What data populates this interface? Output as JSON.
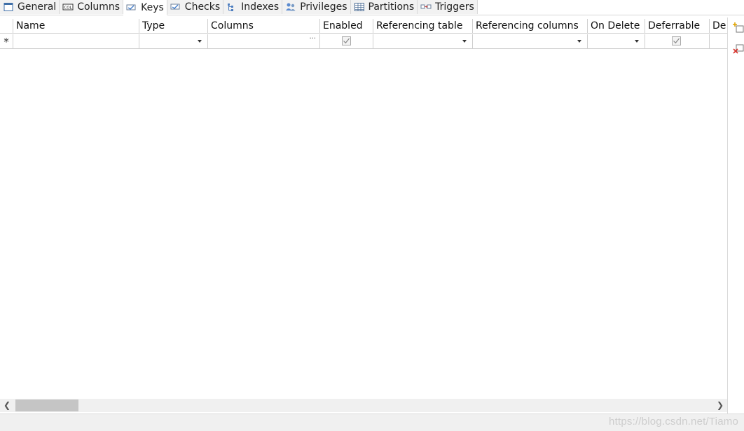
{
  "tabs": [
    {
      "label": "General",
      "icon": "window-icon",
      "active": false
    },
    {
      "label": "Columns",
      "icon": "columns-icon",
      "active": false
    },
    {
      "label": "Keys",
      "icon": "key-icon",
      "active": true
    },
    {
      "label": "Checks",
      "icon": "check-icon",
      "active": false
    },
    {
      "label": "Indexes",
      "icon": "index-icon",
      "active": false
    },
    {
      "label": "Privileges",
      "icon": "users-icon",
      "active": false
    },
    {
      "label": "Partitions",
      "icon": "table-grid-icon",
      "active": false
    },
    {
      "label": "Triggers",
      "icon": "trigger-icon",
      "active": false
    }
  ],
  "table": {
    "columns": [
      {
        "label": "Name"
      },
      {
        "label": "Type"
      },
      {
        "label": "Columns"
      },
      {
        "label": "Enabled"
      },
      {
        "label": "Referencing table"
      },
      {
        "label": "Referencing columns"
      },
      {
        "label": "On Delete"
      },
      {
        "label": "Deferrable"
      },
      {
        "label": "De"
      }
    ],
    "new_row_marker": "*",
    "columns_button": "···"
  },
  "watermark": "https://blog.csdn.net/Tiamo",
  "colors": {
    "tab_bg": "#f2f2f2",
    "grid_line": "#cfcfcf",
    "scroll_thumb": "#c5c5c5",
    "delete_red": "#d9322b"
  }
}
